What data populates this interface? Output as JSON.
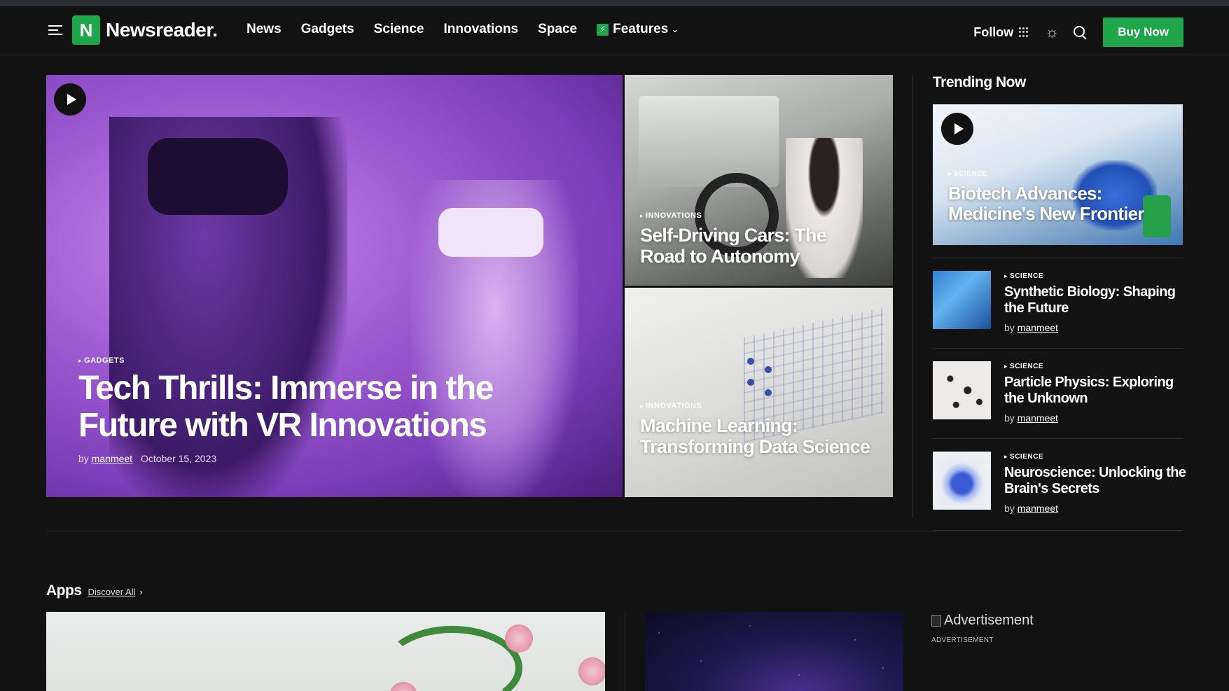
{
  "header": {
    "logo_text": "Newsreader.",
    "nav": [
      "News",
      "Gadgets",
      "Science",
      "Innovations",
      "Space"
    ],
    "features_label": "Features",
    "follow_label": "Follow",
    "buy_label": "Buy Now"
  },
  "hero": {
    "category": "GADGETS",
    "title": "Tech Thrills: Immerse in the Future with VR Innovations",
    "by": "by",
    "author": "manmeet",
    "date": "October 15, 2023"
  },
  "side_cards": [
    {
      "category": "INNOVATIONS",
      "title": "Self-Driving Cars: The Road to Autonomy"
    },
    {
      "category": "INNOVATIONS",
      "title": "Machine Learning: Transforming Data Science"
    }
  ],
  "trending": {
    "heading": "Trending Now",
    "main": {
      "category": "SCIENCE",
      "title": "Biotech Advances: Medicine's New Frontier"
    },
    "items": [
      {
        "category": "SCIENCE",
        "title": "Synthetic Biology: Shaping the Future",
        "by": "by",
        "author": "manmeet"
      },
      {
        "category": "SCIENCE",
        "title": "Particle Physics: Exploring the Unknown",
        "by": "by",
        "author": "manmeet"
      },
      {
        "category": "SCIENCE",
        "title": "Neuroscience: Unlocking the Brain's Secrets",
        "by": "by",
        "author": "manmeet"
      }
    ]
  },
  "apps": {
    "heading": "Apps",
    "discover": "Discover All",
    "arrow": "›"
  },
  "ad": {
    "alt": "Advertisement",
    "label": "ADVERTISEMENT"
  },
  "colors": {
    "accent": "#1fa64a",
    "background": "#121212"
  }
}
